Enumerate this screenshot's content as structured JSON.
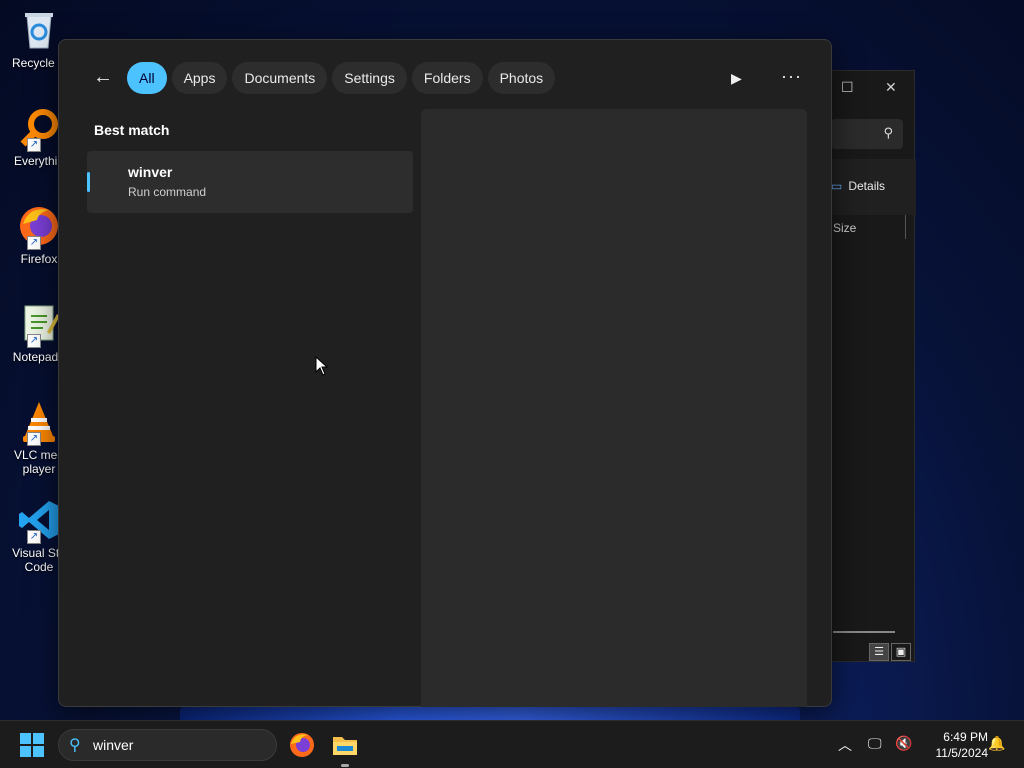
{
  "desktop": {
    "icons": [
      {
        "label": "Recycle B",
        "icon": "recycle-bin-icon"
      },
      {
        "label": "Everythin",
        "icon": "everything-search-icon"
      },
      {
        "label": "Firefox",
        "icon": "firefox-icon"
      },
      {
        "label": "Notepad+",
        "icon": "notepad-plus-icon"
      },
      {
        "label": "VLC med",
        "label2": "player",
        "icon": "vlc-icon"
      },
      {
        "label": "Visual Stu",
        "label2": "Code",
        "icon": "vscode-icon"
      }
    ]
  },
  "explorer": {
    "details_label": "Details",
    "column_size": "Size"
  },
  "search_panel": {
    "filters": [
      "All",
      "Apps",
      "Documents",
      "Settings",
      "Folders",
      "Photos"
    ],
    "active_filter": "All",
    "best_match_heading": "Best match",
    "result": {
      "name": "winver",
      "type": "Run command"
    }
  },
  "taskbar": {
    "search_value": "winver",
    "time": "6:49 PM",
    "date": "11/5/2024",
    "accent_color": "#4cc2ff"
  }
}
